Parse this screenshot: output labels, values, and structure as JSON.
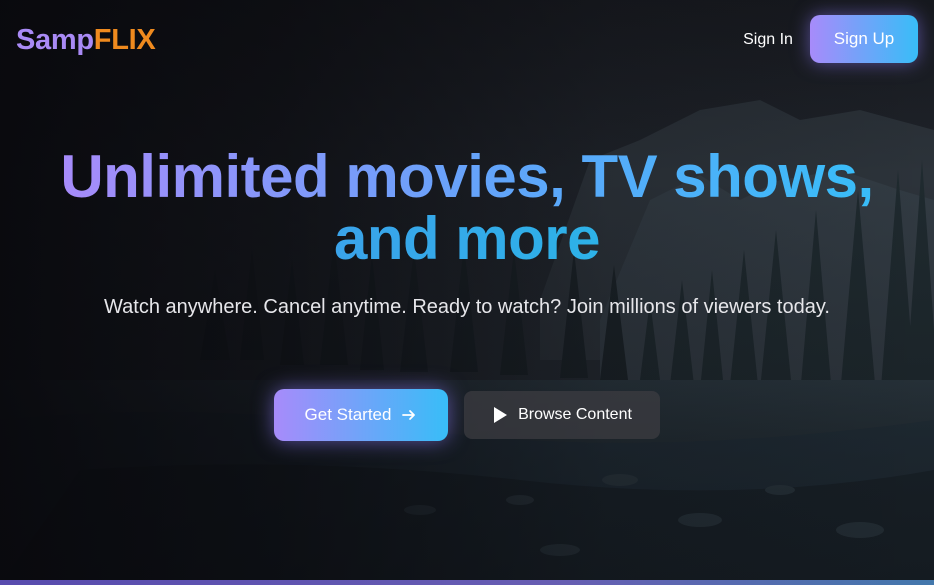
{
  "logo": {
    "part1": "Samp",
    "part2": "FLIX"
  },
  "nav": {
    "signin_label": "Sign In",
    "signup_label": "Sign Up"
  },
  "hero": {
    "title_line1": "Unlimited movies, TV shows,",
    "title_line2": "and more",
    "subtitle": "Watch anywhere. Cancel anytime. Ready to watch? Join millions of viewers today."
  },
  "actions": {
    "primary_label": "Get Started",
    "primary_icon": "arrow-right-icon",
    "secondary_label": "Browse Content",
    "secondary_icon": "play-icon"
  },
  "colors": {
    "logo_primary": "#a98af5",
    "logo_accent": "#ef8a1e",
    "gradient_start": "#a78bfa",
    "gradient_end": "#38bdf8",
    "secondary_button": "#3c3c42"
  },
  "background": {
    "image": "misty-mountain-forest-river"
  }
}
